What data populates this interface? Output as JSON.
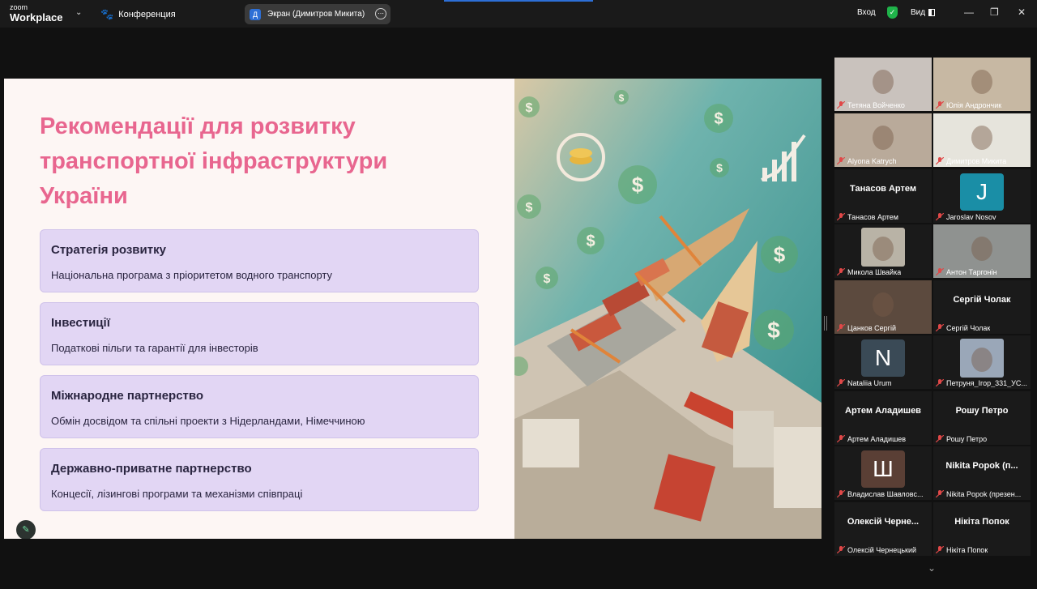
{
  "app": {
    "brand_small": "zoom",
    "brand_name": "Workplace",
    "meeting_label": "Конференция",
    "share_badge": "Д",
    "share_label": "Экран (Димитров Микита)",
    "login_label": "Вход",
    "view_label": "Вид"
  },
  "slide": {
    "title": "Рекомендації для розвитку транспортної інфраструктури України",
    "cards": [
      {
        "heading": "Стратегія розвитку",
        "text": "Національна програма з пріоритетом водного транспорту"
      },
      {
        "heading": "Інвестиції",
        "text": "Податкові пільги та гарантії для інвесторів"
      },
      {
        "heading": "Міжнародне партнерство",
        "text": "Обмін досвідом та спільні проекти з Нідерландами, Німеччиною"
      },
      {
        "heading": "Державно-приватне партнерство",
        "text": "Концесії, лізингові програми та механізми співпраці"
      }
    ],
    "image_symbol": "$"
  },
  "participants": [
    {
      "name": "Тетяна Войченко",
      "kind": "video",
      "color": "#c9c2bd"
    },
    {
      "name": "Юлія Андрончик",
      "kind": "video",
      "color": "#c7b8a3"
    },
    {
      "name": "Alyona Katrych",
      "kind": "video",
      "color": "#b9aa9a"
    },
    {
      "name": "Димитров Микита",
      "kind": "video",
      "color": "#e6e4dc"
    },
    {
      "name": "Танасов Артем",
      "kind": "text",
      "display": "Танасов Артем"
    },
    {
      "name": "Jaroslav Nosov",
      "kind": "avatar",
      "initial": "J",
      "color": "#1a8ea6"
    },
    {
      "name": "Микола Швайка",
      "kind": "photo",
      "color": "#b9b3a6"
    },
    {
      "name": "Антон Таргонін",
      "kind": "video",
      "color": "#8f9290"
    },
    {
      "name": "Цанков Сергій",
      "kind": "video",
      "color": "#5c4a3e"
    },
    {
      "name": "Сергій Чолак",
      "kind": "text",
      "display": "Сергій Чолак"
    },
    {
      "name": "Nataliia Urum",
      "kind": "avatar",
      "initial": "N",
      "color": "#3a4a56"
    },
    {
      "name": "Петруня_Ігор_331_УС...",
      "kind": "photo",
      "color": "#9aa7b8"
    },
    {
      "name": "Артем Аладишев",
      "kind": "text",
      "display": "Артем Аладишев"
    },
    {
      "name": "Рошу Петро",
      "kind": "text",
      "display": "Рошу Петро"
    },
    {
      "name": "Владислав Шавловс...",
      "kind": "avatar",
      "initial": "Ш",
      "color": "#5a3f35"
    },
    {
      "name": "Nikita Popok (презен...",
      "kind": "text",
      "display": "Nikita Popok (п..."
    },
    {
      "name": "Олексій Чернецький",
      "kind": "text",
      "display": "Олексій Черне..."
    },
    {
      "name": "Нікіта Попок",
      "kind": "text",
      "display": "Нікіта Попок"
    }
  ],
  "colors": {
    "title_pink": "#e8668f",
    "card_lavender": "#e2d6f4",
    "active_speaker": "#3ad36b",
    "mute_red": "#e04848"
  }
}
